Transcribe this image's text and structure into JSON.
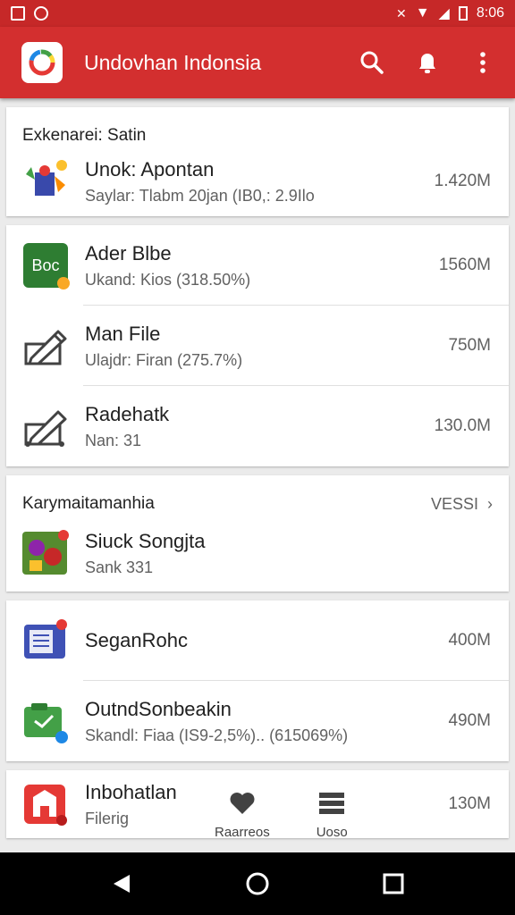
{
  "status_bar": {
    "time": "8:06"
  },
  "app_bar": {
    "title": "Undovhan Indonsia",
    "actions": [
      "search-icon",
      "notification-icon",
      "more-icon"
    ]
  },
  "sections": [
    {
      "title": "Exkenarei: Satin",
      "items": [
        {
          "title": "Unok: Apontan",
          "subtitle": "Saylar: Tlabm 20jan (IB0,: 2.9Ilo",
          "size": "1.420M"
        }
      ]
    },
    {
      "items": [
        {
          "title": "Ader Blbe",
          "subtitle": "Ukand: Kios (318.50%)",
          "size": "1560M",
          "icon_text": "Boc"
        },
        {
          "title": "Man File",
          "subtitle": "Ulajdr: Firan (275.7%)",
          "size": "750M"
        },
        {
          "title": "Radehatk",
          "subtitle": "Nan: 31",
          "size": "130.0M"
        }
      ]
    },
    {
      "title": "Karymaitamanhia",
      "link": "VESSI",
      "items": [
        {
          "title": "Siuck Songjta",
          "subtitle": "Sank 331"
        }
      ]
    },
    {
      "items": [
        {
          "title": "SeganRohc",
          "size": "400M"
        },
        {
          "title": "OutndSonbeakin",
          "subtitle": "Skandl: Fiaa (IS9-2,5%).. (615069%)",
          "size": "490M"
        }
      ]
    },
    {
      "items": [
        {
          "title": "Inbohatlan",
          "subtitle": "Filerig",
          "size": "130M"
        }
      ]
    }
  ],
  "bottom_tabs": [
    {
      "label": "Raarreos",
      "icon": "heart-icon"
    },
    {
      "label": "Uoso",
      "icon": "list-icon"
    }
  ],
  "colors": {
    "primary": "#d32f2f",
    "status_bar": "#c62828"
  }
}
